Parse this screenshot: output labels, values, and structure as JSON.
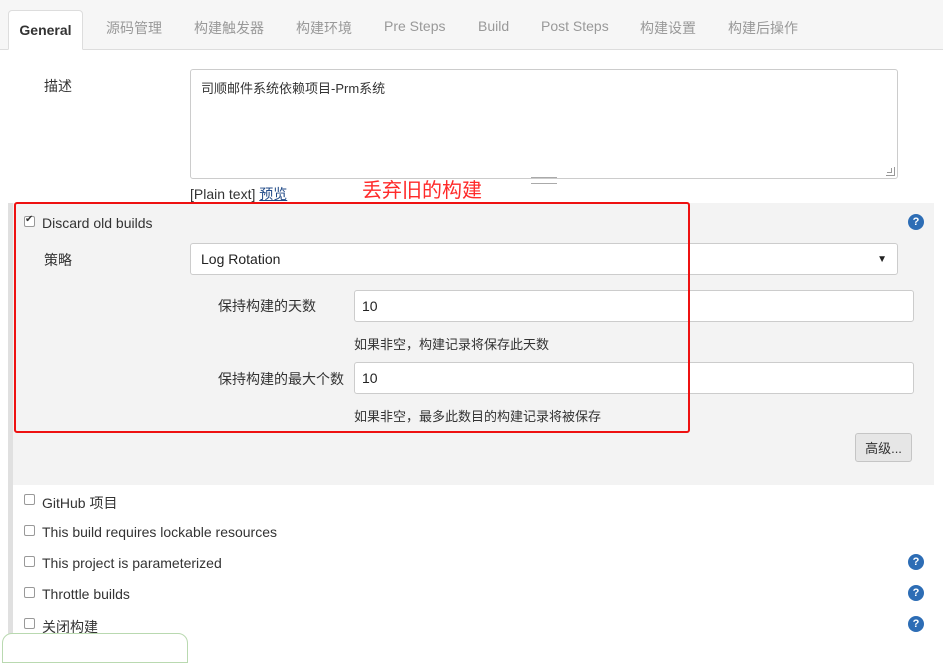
{
  "tabs": [
    "General",
    "源码管理",
    "构建触发器",
    "构建环境",
    "Pre Steps",
    "Build",
    "Post Steps",
    "构建设置",
    "构建后操作"
  ],
  "description": {
    "label": "描述",
    "value": "司顺邮件系统依赖项目-Prm系统",
    "plain_text": "[Plain text]",
    "preview_link": "预览"
  },
  "annotation": "丢弃旧的构建",
  "discard": {
    "label": "Discard old builds",
    "checked": true,
    "strategy_label": "策略",
    "strategy_value": "Log Rotation",
    "days_label": "保持构建的天数",
    "days_value": "10",
    "days_hint": "如果非空，构建记录将保存此天数",
    "max_label": "保持构建的最大个数",
    "max_value": "10",
    "max_hint": "如果非空，最多此数目的构建记录将被保存",
    "advanced_button": "高级..."
  },
  "options": [
    {
      "label": "GitHub 项目",
      "checked": false
    },
    {
      "label": "This build requires lockable resources",
      "checked": false
    },
    {
      "label": "This project is parameterized",
      "checked": false
    },
    {
      "label": "Throttle builds",
      "checked": false
    },
    {
      "label": "关闭构建",
      "checked": false
    }
  ],
  "help_icon": "?",
  "colors": {
    "accent_red": "#ee1111",
    "help_blue": "#2d6db5",
    "link": "#204a87"
  }
}
